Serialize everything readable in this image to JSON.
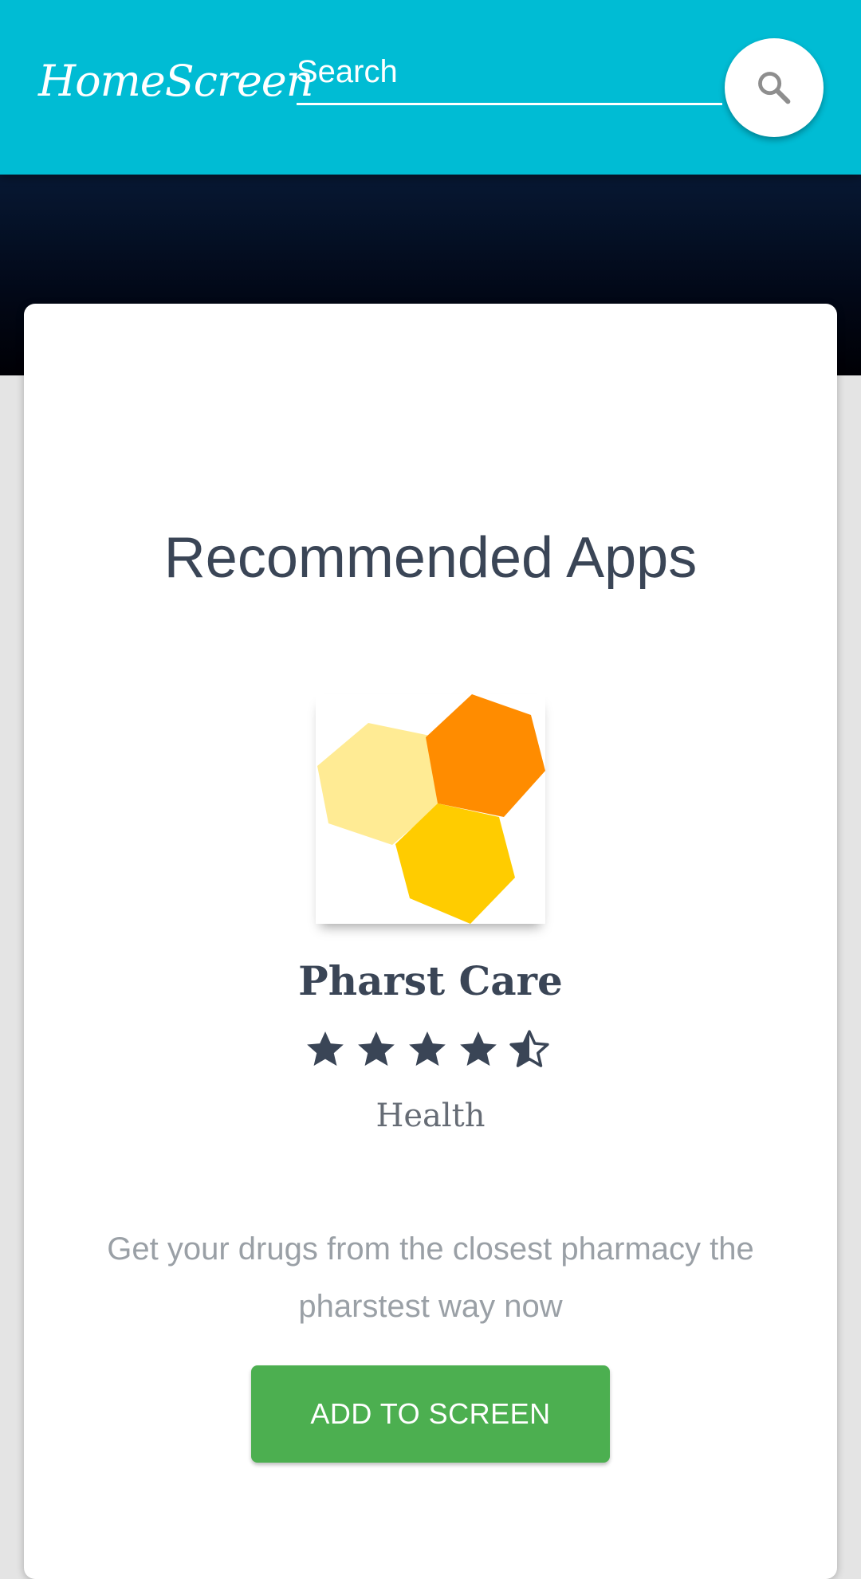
{
  "header": {
    "logo": "HomeScreen",
    "search": {
      "placeholder": "Search",
      "value": ""
    },
    "search_icon": "search-icon"
  },
  "main": {
    "section_title": "Recommended Apps",
    "app": {
      "name": "Pharst Care",
      "rating": 4.5,
      "rating_max": 5,
      "category": "Health",
      "description": "Get your drugs from the closest pharmacy the pharstest way now",
      "add_button_label": "ADD TO SCREEN",
      "icon": "hexagon-cluster-icon"
    }
  },
  "colors": {
    "header": "#00bcd4",
    "hero": "#020817",
    "button": "#4caf50",
    "text_dark": "#3a4556",
    "hex_light": "#ffeb94",
    "hex_orange": "#ff8c00",
    "hex_yellow": "#ffcc00"
  }
}
